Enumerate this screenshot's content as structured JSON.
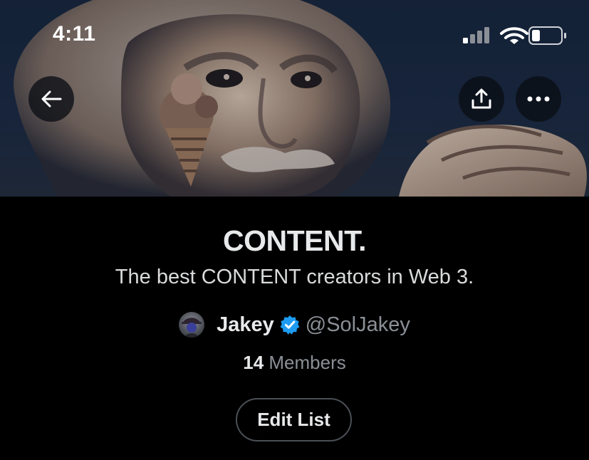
{
  "status_bar": {
    "time": "4:11",
    "icons": [
      "cellular-signal-icon",
      "wifi-icon",
      "battery-icon"
    ]
  },
  "banner": {
    "buttons": [
      "back-arrow-icon",
      "share-icon",
      "more-icon"
    ]
  },
  "list": {
    "title": "CONTENT.",
    "description": "The best CONTENT creators in Web 3.",
    "owner": {
      "name": "Jakey",
      "handle": "@SolJakey",
      "verified": true
    },
    "members_count": "14",
    "members_label": "Members",
    "edit_label": "Edit List"
  },
  "colors": {
    "background": "#000000",
    "text_primary": "#e7e9ea",
    "text_secondary": "#8b9096",
    "verified_blue": "#1d9bf0",
    "button_border": "#4a4f55"
  }
}
